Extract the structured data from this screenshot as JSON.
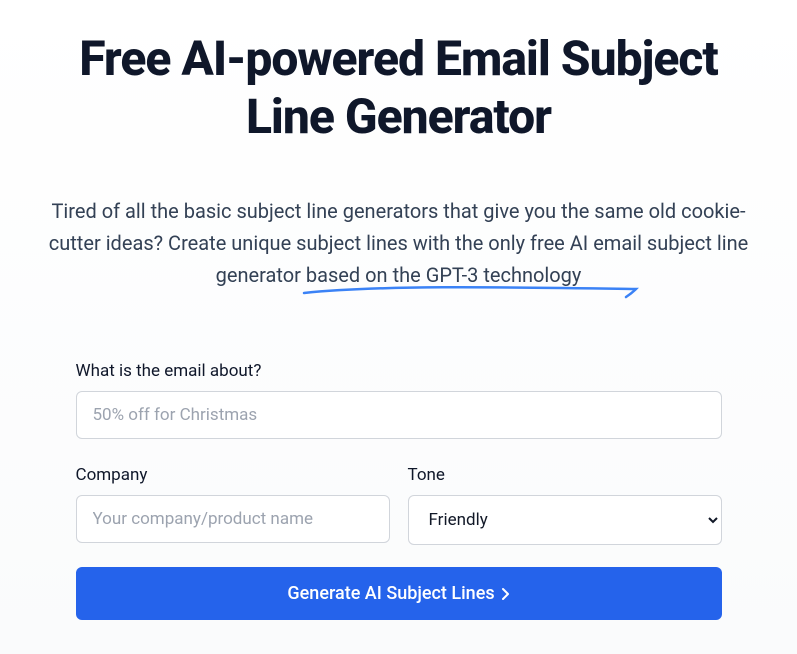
{
  "header": {
    "title": "Free AI-powered Email Subject Line Generator",
    "subtitle_before": "Tired of all the basic subject line generators that give you the same old cookie-cutter ideas? Create unique subject lines with the only free AI email subject line generator ",
    "subtitle_underlined": "based on the GPT-3 technology"
  },
  "form": {
    "about": {
      "label": "What is the email about?",
      "placeholder": "50% off for Christmas",
      "value": ""
    },
    "company": {
      "label": "Company",
      "placeholder": "Your company/product name",
      "value": ""
    },
    "tone": {
      "label": "Tone",
      "selected": "Friendly"
    },
    "submit_label": "Generate AI Subject Lines"
  },
  "colors": {
    "primary": "#2563eb",
    "underline": "#3b82f6"
  }
}
